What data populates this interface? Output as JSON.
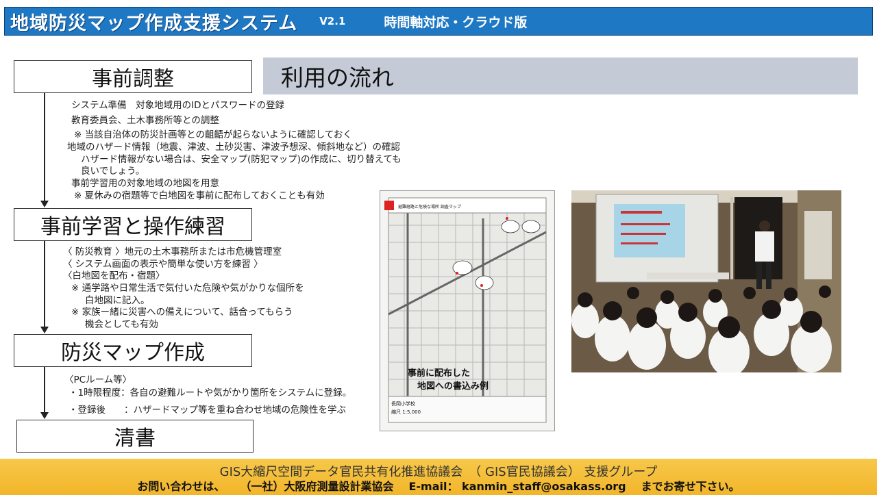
{
  "header": {
    "title": "地域防災マップ作成支援システム",
    "version": "V2.1",
    "subtitle": "時間軸対応・クラウド版"
  },
  "flow_title": "利用の流れ",
  "steps": [
    {
      "label": "事前調整"
    },
    {
      "label": "事前学習と操作練習"
    },
    {
      "label": "防災マップ作成"
    },
    {
      "label": "清書"
    }
  ],
  "notes": {
    "prep": [
      "システム準備　対象地域用のIDとパスワードの登録",
      "教育委員会、土木事務所等との調整",
      "※ 当該自治体の防災計画等との齟齬が起らないように確認しておく",
      "地域のハザード情報（地震、津波、土砂災害、津波予想深、傾斜地など）の確認",
      "ハザード情報がない場合は、安全マップ(防犯マップ)の作成に、切り替えても",
      "良いでしょう。",
      "事前学習用の対象地域の地図を用意",
      "※ 夏休みの宿題等で白地図を事前に配布しておくことも有効"
    ],
    "study": [
      "〈 防災教育 〉地元の土木事務所または市危機管理室",
      "〈 システム画面の表示や簡単な使い方を練習 〉",
      "〈白地図を配布・宿題〉",
      "※ 通学路や日常生活で気付いた危険や気がかりな個所を",
      "白地図に記入。",
      "※ 家族ー緒に災害への備えについて、話合ってもらう",
      "機会としても有効"
    ],
    "make": [
      "〈PCルーム等〉",
      "・1時限程度：各自の避難ルートや気がかり箇所をシステムに登録。",
      "・登録後　　：ハザードマップ等を重ね合わせ地域の危険性を学ぶ"
    ]
  },
  "map_caption": [
    "事前に配布した",
    "地図への書込み例"
  ],
  "map_texts": {
    "header": "避難経路と危険な場所 調査マップ",
    "school": "長岡小学校",
    "scale": "縮尺 1:5,000"
  },
  "footer": {
    "line1": "GIS大縮尺空間データ官民共有化推進協議会　（ GIS官民協議会） 支援グループ",
    "contact_prefix": "お問い合わせは、",
    "org": "（一社）大阪府測量設計業協会",
    "email_label": "E-mail：",
    "email": "kanmin_staff@osakass.org",
    "contact_suffix": "までお寄せ下さい。"
  }
}
